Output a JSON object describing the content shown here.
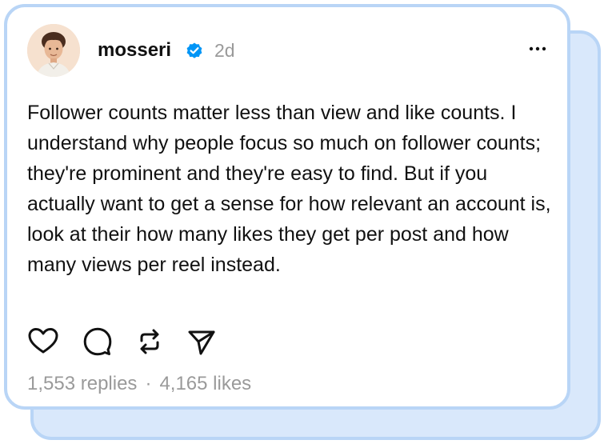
{
  "post": {
    "username": "mosseri",
    "timestamp": "2d",
    "text": "Follower counts matter less than view and like counts. I understand why people focus so much on follower counts; they're prominent and they're easy to find. But if you actually want to get a sense for how relevant an account is, look at their how many likes they get per post and how many views per reel instead.",
    "replies": "1,553 replies",
    "separator": "·",
    "likes": "4,165 likes"
  },
  "icons": {
    "verified": "verified-badge-icon",
    "more": "more-options-icon",
    "like": "heart-icon",
    "comment": "comment-icon",
    "repost": "repost-icon",
    "share": "send-icon"
  },
  "colors": {
    "card_border": "#b9d5f6",
    "back_card_fill": "#d9e8fb",
    "verified_blue": "#0095f6",
    "muted_text": "#9a9a9a",
    "text": "#111111"
  }
}
